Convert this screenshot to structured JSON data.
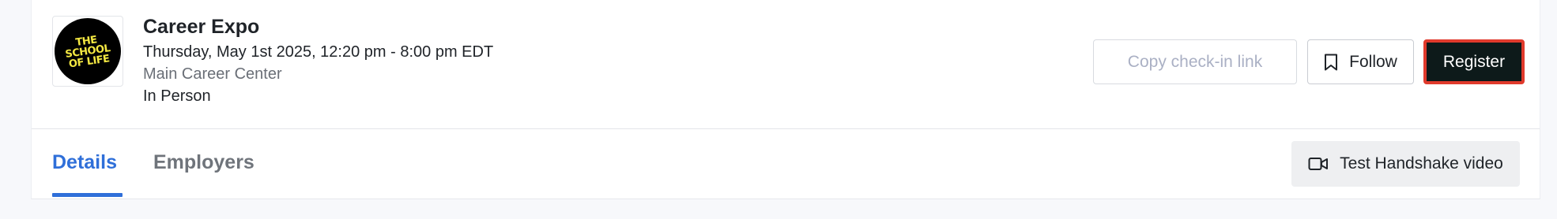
{
  "event": {
    "logo_text": "THE SCHOOL OF LIFE",
    "title": "Career Expo",
    "datetime": "Thursday, May 1st 2025, 12:20 pm - 8:00 pm EDT",
    "location": "Main Career Center",
    "mode": "In Person"
  },
  "actions": {
    "copy_label": "Copy check-in link",
    "follow_label": "Follow",
    "register_label": "Register"
  },
  "tabs": {
    "details": "Details",
    "employers": "Employers"
  },
  "video_button": {
    "label": "Test Handshake video"
  },
  "colors": {
    "accent": "#2f6fd9",
    "register_bg": "#0d1a1a",
    "highlight": "#e03a2c",
    "logo_yellow": "#f4e842"
  },
  "icons": {
    "follow": "bookmark-icon",
    "video": "video-camera-icon"
  }
}
